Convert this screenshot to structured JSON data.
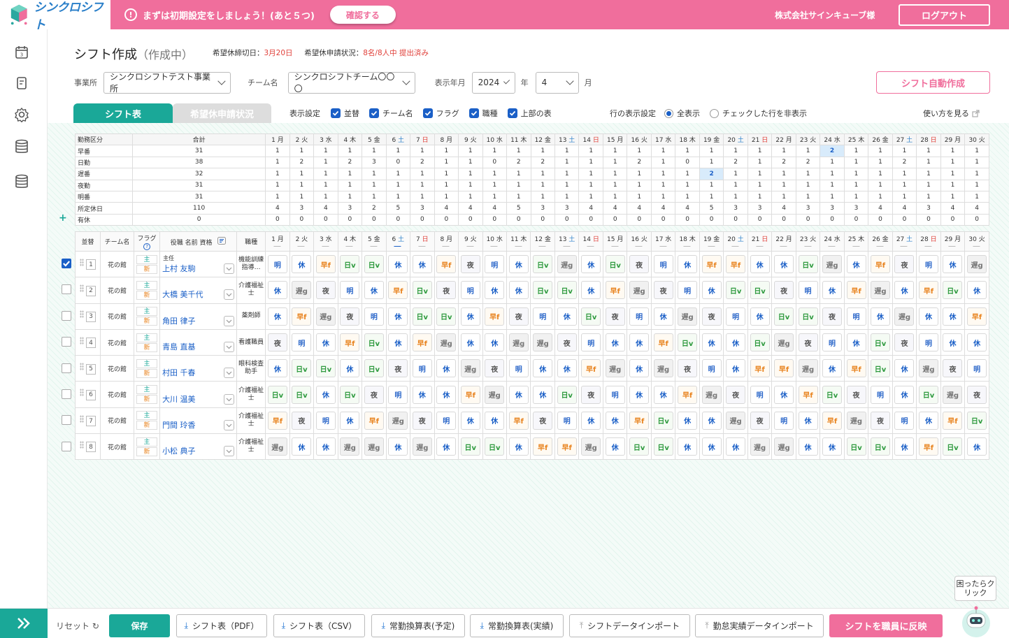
{
  "app": {
    "name": "シンクロシフト",
    "notice": "まずは初期設定をしましょう！(あと５つ)",
    "confirm_label": "確認する",
    "company": "株式会社サインキューブ様",
    "logout_label": "ログアウト"
  },
  "page": {
    "title": "シフト作成",
    "status": "（作成中）",
    "deadline_label": "希望休締切日：",
    "deadline": "3月20日",
    "request_label": "希望休申請状況：",
    "request_value": "8名/8人中 提出済み"
  },
  "filters": {
    "office_label": "事業所",
    "office": "シンクロシフトテスト事業所",
    "team_label": "チーム名",
    "team": "シンクロシフトチーム〇〇〇",
    "ym_label": "表示年月",
    "year": "2024",
    "year_unit": "年",
    "month": "4",
    "month_unit": "月"
  },
  "auto_create_label": "シフト自動作成",
  "tabs": {
    "shift": "シフト表",
    "requests": "希望休申請状況"
  },
  "display": {
    "label": "表示設定",
    "options": [
      "並替",
      "チーム名",
      "フラグ",
      "職種",
      "上部の表"
    ]
  },
  "row_display": {
    "label": "行の表示設定",
    "all": "全表示",
    "hide": "チェックした行を非表示"
  },
  "howto": "使い方を見る",
  "days": [
    "1",
    "2",
    "3",
    "4",
    "5",
    "6",
    "7",
    "8",
    "9",
    "10",
    "11",
    "12",
    "13",
    "14",
    "15",
    "16",
    "17",
    "18",
    "19",
    "20",
    "21",
    "22",
    "23",
    "24",
    "25",
    "26",
    "27",
    "28",
    "29",
    "30"
  ],
  "month_word": "月",
  "weekdays": [
    "月",
    "火",
    "水",
    "木",
    "金",
    "土",
    "日",
    "月",
    "火",
    "水",
    "木",
    "金",
    "土",
    "日",
    "月",
    "火",
    "水",
    "木",
    "金",
    "土",
    "日",
    "月",
    "火",
    "水",
    "木",
    "金",
    "土",
    "日",
    "月",
    "火"
  ],
  "summary": {
    "head_label": "勤務区分",
    "total_label": "合計",
    "rows": [
      {
        "name": "早番",
        "total": "31",
        "vals": [
          "1",
          "1",
          "1",
          "1",
          "1",
          "1",
          "1",
          "1",
          "1",
          "1",
          "1",
          "1",
          "1",
          "1",
          "1",
          "1",
          "1",
          "1",
          "1",
          "1",
          "1",
          "1",
          "1",
          "2",
          "1",
          "1",
          "1",
          "1",
          "1",
          "1"
        ]
      },
      {
        "name": "日勤",
        "total": "38",
        "vals": [
          "1",
          "2",
          "1",
          "2",
          "3",
          "0",
          "2",
          "1",
          "1",
          "0",
          "2",
          "2",
          "1",
          "1",
          "1",
          "2",
          "1",
          "0",
          "1",
          "2",
          "1",
          "2",
          "2",
          "1",
          "1",
          "1",
          "2",
          "1",
          "1",
          "1"
        ]
      },
      {
        "name": "遅番",
        "total": "32",
        "vals": [
          "1",
          "1",
          "1",
          "1",
          "1",
          "1",
          "1",
          "1",
          "1",
          "1",
          "1",
          "1",
          "1",
          "1",
          "1",
          "1",
          "1",
          "1",
          "2",
          "1",
          "1",
          "1",
          "1",
          "1",
          "1",
          "1",
          "1",
          "1",
          "1",
          "1"
        ]
      },
      {
        "name": "夜勤",
        "total": "31",
        "vals": [
          "1",
          "1",
          "1",
          "1",
          "1",
          "1",
          "1",
          "1",
          "1",
          "1",
          "1",
          "1",
          "1",
          "1",
          "1",
          "1",
          "1",
          "1",
          "1",
          "1",
          "1",
          "1",
          "1",
          "1",
          "1",
          "1",
          "1",
          "1",
          "1",
          "1"
        ]
      },
      {
        "name": "明番",
        "total": "31",
        "vals": [
          "1",
          "1",
          "1",
          "1",
          "1",
          "1",
          "1",
          "1",
          "1",
          "1",
          "1",
          "1",
          "1",
          "1",
          "1",
          "1",
          "1",
          "1",
          "1",
          "1",
          "1",
          "1",
          "1",
          "1",
          "1",
          "1",
          "1",
          "1",
          "1",
          "1"
        ]
      },
      {
        "name": "所定休日",
        "total": "110",
        "vals": [
          "4",
          "3",
          "4",
          "3",
          "2",
          "5",
          "3",
          "4",
          "4",
          "4",
          "5",
          "3",
          "3",
          "4",
          "4",
          "4",
          "4",
          "4",
          "5",
          "3",
          "3",
          "4",
          "3",
          "3",
          "3",
          "4",
          "4",
          "3",
          "4",
          "4"
        ]
      },
      {
        "name": "有休",
        "total": "0",
        "vals": [
          "0",
          "0",
          "0",
          "0",
          "0",
          "0",
          "0",
          "0",
          "0",
          "0",
          "0",
          "0",
          "0",
          "0",
          "0",
          "0",
          "0",
          "0",
          "0",
          "0",
          "0",
          "0",
          "0",
          "0",
          "0",
          "0",
          "0",
          "0",
          "0",
          "0"
        ]
      }
    ]
  },
  "grid": {
    "headers": {
      "sort": "並替",
      "team": "チーム名",
      "flag": "フラグ",
      "name": "役職 名前 資格",
      "job": "職種"
    },
    "flag_main": "主",
    "flag_new": "新",
    "staff": [
      {
        "idx": "1",
        "team": "花の館",
        "title": "主任",
        "name": "上村 友駒",
        "job": "機能訓練指導…",
        "checked": true,
        "shifts": [
          "明",
          "休",
          "早f",
          "日v",
          "日v",
          "休",
          "休",
          "早f",
          "夜",
          "明",
          "休",
          "日v",
          "遅g",
          "休",
          "日v",
          "夜",
          "明",
          "休",
          "早f",
          "早f",
          "休",
          "休",
          "日v",
          "遅g",
          "休",
          "早f",
          "夜",
          "明",
          "休",
          "遅g"
        ]
      },
      {
        "idx": "2",
        "team": "花の館",
        "title": "",
        "name": "大橋 美千代",
        "job": "介護福祉士",
        "checked": false,
        "shifts": [
          "休",
          "遅g",
          "夜",
          "明",
          "休",
          "早f",
          "日v",
          "夜",
          "明",
          "休",
          "休",
          "日v",
          "日v",
          "休",
          "早f",
          "遅g",
          "夜",
          "明",
          "休",
          "日v",
          "日v",
          "夜",
          "明",
          "休",
          "早f",
          "遅g",
          "休",
          "早f",
          "日v",
          "休"
        ]
      },
      {
        "idx": "3",
        "team": "花の館",
        "title": "",
        "name": "角田 律子",
        "job": "薬剤師",
        "checked": false,
        "shifts": [
          "休",
          "早f",
          "遅g",
          "夜",
          "明",
          "休",
          "日v",
          "日v",
          "休",
          "早f",
          "夜",
          "明",
          "休",
          "日v",
          "夜",
          "明",
          "休",
          "遅g",
          "夜",
          "明",
          "休",
          "日v",
          "日v",
          "夜",
          "明",
          "休",
          "遅g",
          "休",
          "休",
          "早f"
        ]
      },
      {
        "idx": "4",
        "team": "花の館",
        "title": "",
        "name": "青島 直基",
        "job": "看護職員",
        "checked": false,
        "shifts": [
          "夜",
          "明",
          "休",
          "早f",
          "日v",
          "休",
          "早f",
          "遅g",
          "休",
          "休",
          "遅g",
          "遅g",
          "夜",
          "明",
          "休",
          "休",
          "早f",
          "日v",
          "休",
          "休",
          "日v",
          "遅g",
          "夜",
          "明",
          "休",
          "日v",
          "夜",
          "明",
          "休",
          "休"
        ]
      },
      {
        "idx": "5",
        "team": "花の館",
        "title": "",
        "name": "村田 千春",
        "job": "眼科検査助手",
        "checked": false,
        "shifts": [
          "休",
          "日v",
          "日v",
          "休",
          "日v",
          "夜",
          "明",
          "休",
          "遅g",
          "夜",
          "明",
          "休",
          "休",
          "早f",
          "遅g",
          "休",
          "遅g",
          "夜",
          "明",
          "休",
          "早f",
          "早f",
          "遅g",
          "休",
          "早f",
          "日v",
          "休",
          "遅g",
          "夜",
          "明"
        ]
      },
      {
        "idx": "6",
        "team": "花の館",
        "title": "",
        "name": "大川 温美",
        "job": "介護福祉士",
        "checked": false,
        "shifts": [
          "日v",
          "日v",
          "休",
          "日v",
          "夜",
          "明",
          "休",
          "休",
          "早f",
          "遅g",
          "休",
          "休",
          "日v",
          "夜",
          "明",
          "休",
          "休",
          "早f",
          "遅g",
          "夜",
          "明",
          "休",
          "早f",
          "日v",
          "夜",
          "明",
          "休",
          "日v",
          "遅g",
          "夜"
        ]
      },
      {
        "idx": "7",
        "team": "花の館",
        "title": "",
        "name": "門間 玲香",
        "job": "介護福祉士",
        "checked": false,
        "shifts": [
          "早f",
          "夜",
          "明",
          "休",
          "早f",
          "遅g",
          "夜",
          "明",
          "休",
          "休",
          "早f",
          "夜",
          "明",
          "休",
          "休",
          "早f",
          "日v",
          "休",
          "休",
          "遅g",
          "夜",
          "明",
          "休",
          "早f",
          "遅g",
          "夜",
          "明",
          "休",
          "早f",
          "日v"
        ]
      },
      {
        "idx": "8",
        "team": "花の館",
        "title": "",
        "name": "小松 典子",
        "job": "介護福祉士",
        "checked": false,
        "shifts": [
          "遅g",
          "休",
          "休",
          "遅g",
          "遅g",
          "休",
          "遅g",
          "休",
          "日v",
          "日v",
          "休",
          "早f",
          "早f",
          "遅g",
          "休",
          "日v",
          "日v",
          "休",
          "休",
          "休",
          "遅g",
          "遅g",
          "休",
          "休",
          "日v",
          "日v",
          "休",
          "早f",
          "日v",
          "休"
        ]
      }
    ]
  },
  "footer": {
    "reset": "リセット",
    "save": "保存",
    "pdf": "シフト表（PDF）",
    "csv": "シフト表（CSV）",
    "conv_plan": "常勤換算表(予定)",
    "conv_actual": "常勤換算表(実績)",
    "import_shift": "シフトデータインポート",
    "import_att": "勤怠実績データインポート",
    "publish": "シフトを職員に反映"
  },
  "help_label": "困ったらクリック",
  "colors": {
    "brand_pink": "#f06e9c",
    "teal": "#1aa898",
    "blue": "#1a5fc7"
  }
}
